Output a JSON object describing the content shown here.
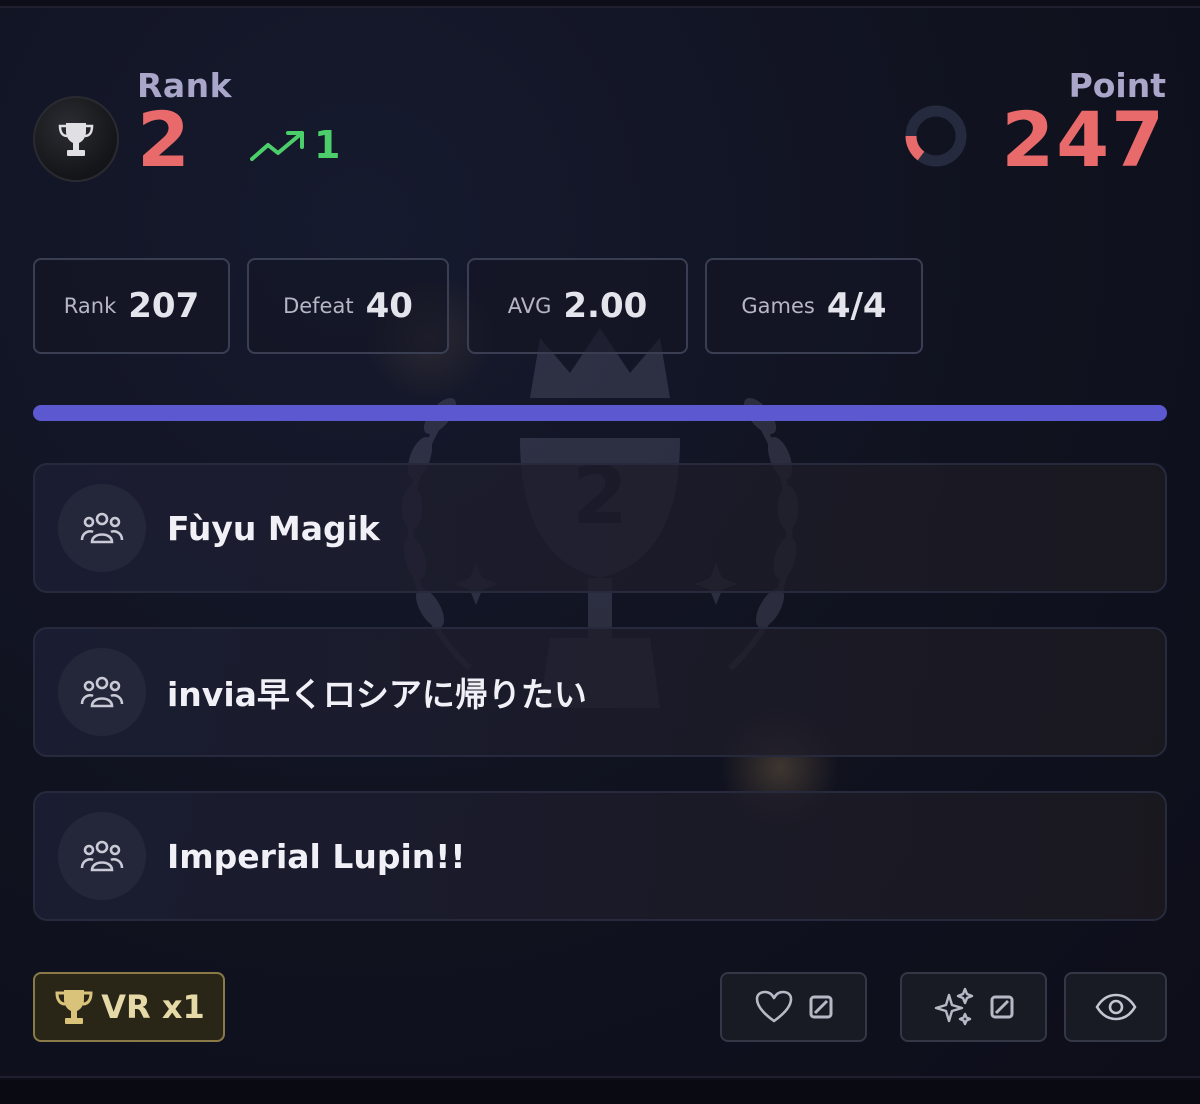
{
  "header": {
    "rank_title": "Rank",
    "rank_value": "2",
    "rank_change": "1",
    "point_title": "Point",
    "point_value": "247"
  },
  "stats": [
    {
      "label": "Rank",
      "value": "207"
    },
    {
      "label": "Defeat",
      "value": "40"
    },
    {
      "label": "AVG",
      "value": "2.00"
    },
    {
      "label": "Games",
      "value": "4/4"
    }
  ],
  "progress": {
    "fraction": 1.0
  },
  "emblem": {
    "rank_number": "2"
  },
  "teams": [
    {
      "name": "Fùyu Magik",
      "icon": "team-icon"
    },
    {
      "name": "invia早くロシアに帰りたい",
      "icon": "team-icon"
    },
    {
      "name": "Imperial Lupin!!",
      "icon": "team-icon"
    }
  ],
  "footer": {
    "vr_label": "VR x1",
    "like_icon": "heart-icon",
    "sparkle_icon": "sparkle-icon",
    "view_icon": "eye-icon"
  },
  "colors": {
    "accent_red": "#e86a6a",
    "trend_green": "#4ccf6a",
    "progress": "#5b58d0",
    "gold": "#d9c27a"
  }
}
